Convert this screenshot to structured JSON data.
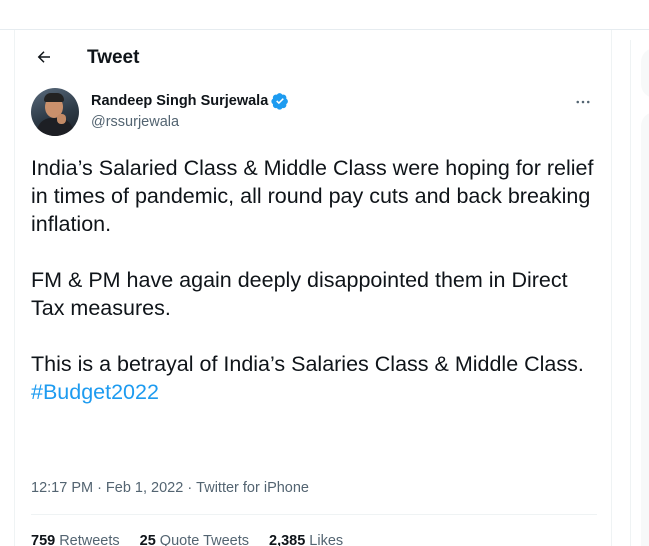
{
  "header": {
    "title": "Tweet"
  },
  "author": {
    "display_name": "Randeep Singh Surjewala",
    "handle": "@rssurjewala"
  },
  "tweet": {
    "para1": "India’s Salaried Class & Middle Class were hoping for relief in times of pandemic, all round pay cuts and back breaking inflation.",
    "para2": "FM & PM have again deeply disappointed them in Direct Tax measures.",
    "para3": "This is a betrayal of India’s Salaries Class & Middle Class.",
    "hashtag": "#Budget2022"
  },
  "meta": {
    "time": "12:17 PM",
    "sep1": "·",
    "date": "Feb 1, 2022",
    "sep2": "·",
    "source": "Twitter for iPhone"
  },
  "stats": {
    "retweets_count": "759",
    "retweets_label": "Retweets",
    "quotes_count": "25",
    "quotes_label": "Quote Tweets",
    "likes_count": "2,385",
    "likes_label": "Likes"
  },
  "colors": {
    "accent": "#1d9bf0",
    "text": "#0f1419",
    "muted": "#536471"
  },
  "icons": {
    "back": "arrow-left-icon",
    "verified": "verified-badge-icon",
    "more": "more-horizontal-icon"
  }
}
